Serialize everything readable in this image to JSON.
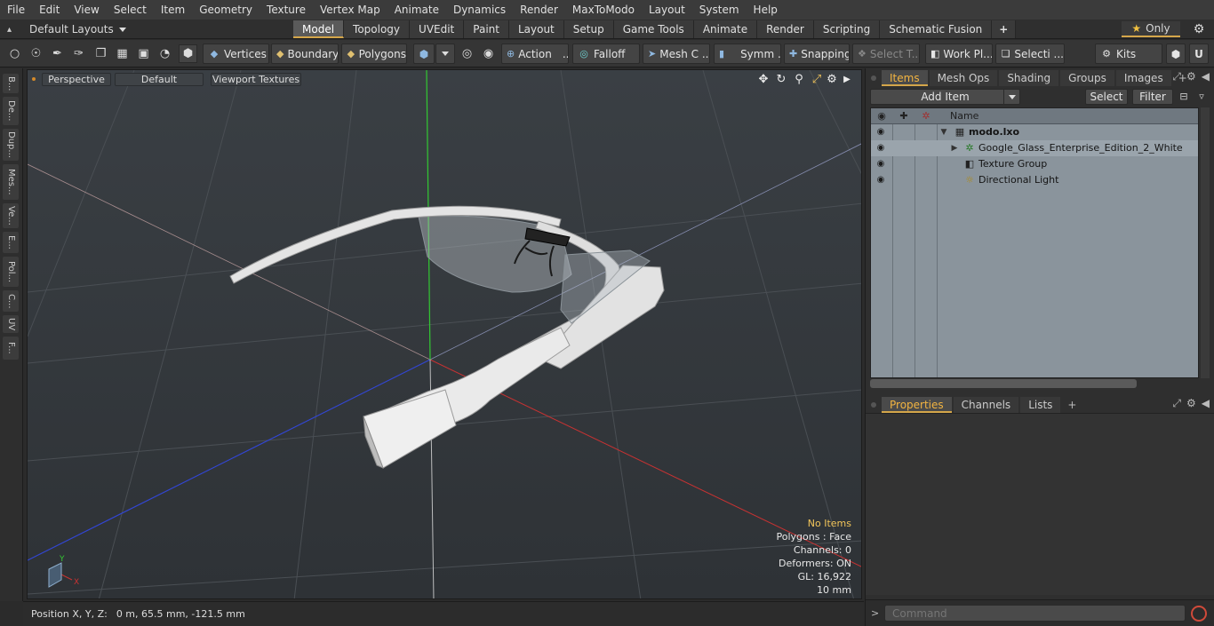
{
  "menubar": {
    "items": [
      "File",
      "Edit",
      "View",
      "Select",
      "Item",
      "Geometry",
      "Texture",
      "Vertex Map",
      "Animate",
      "Dynamics",
      "Render",
      "MaxToModo",
      "Layout",
      "System",
      "Help"
    ]
  },
  "layoutbar": {
    "layout_label": "Default Layouts",
    "tabs": [
      "Model",
      "Topology",
      "UVEdit",
      "Paint",
      "Layout",
      "Setup",
      "Game Tools",
      "Animate",
      "Render",
      "Scripting",
      "Schematic Fusion"
    ],
    "active_tab": "Model",
    "add_tab": "+",
    "only_label": "Only"
  },
  "toolbar": {
    "vertices": "Vertices",
    "boundary": "Boundary",
    "polygons": "Polygons",
    "action": "Action",
    "action_more": "...",
    "falloff": "Falloff",
    "mesh": "Mesh C ...",
    "symmetry": "Symm ...",
    "snapping": "Snapping",
    "select_tool": "Select T...",
    "workplane": "Work Pl...",
    "selection": "Selecti ...",
    "kits": "Kits"
  },
  "leftstrip": {
    "tabs": [
      "B...",
      "De...",
      "Dup...",
      "Mes...",
      "Ve...",
      "E...",
      "Pol...",
      "C...",
      "UV",
      "F..."
    ]
  },
  "viewport": {
    "view_mode": "Perspective",
    "shading": "Default",
    "textures": "Viewport Textures",
    "axis_y": "Y",
    "axis_x": "X",
    "hud": {
      "no_items": "No Items",
      "polygons": "Polygons : Face",
      "channels": "Channels: 0",
      "deformers": "Deformers: ON",
      "gl": "GL: 16,922",
      "scale": "10 mm"
    },
    "colors": {
      "x_axis": "#c83232",
      "y_axis": "#32c832",
      "z_axis": "#3246d2",
      "highlight": "#f2c55a"
    }
  },
  "statusbar": {
    "label": "Position X, Y, Z:",
    "value": "0 m, 65.5 mm, -121.5 mm"
  },
  "items_panel": {
    "tabs": [
      "Items",
      "Mesh Ops",
      "Shading",
      "Groups",
      "Images"
    ],
    "active_tab": "Items",
    "add_item": "Add Item",
    "select": "Select",
    "filter": "Filter",
    "name_header": "Name",
    "rows": [
      {
        "name": "modo.lxo",
        "icon": "scene-icon"
      },
      {
        "name": "Google_Glass_Enterprise_Edition_2_White",
        "icon": "mesh-locator-icon"
      },
      {
        "name": "Texture Group",
        "icon": "texture-group-icon"
      },
      {
        "name": "Directional Light",
        "icon": "light-icon"
      }
    ]
  },
  "props_panel": {
    "tabs": [
      "Properties",
      "Channels",
      "Lists"
    ],
    "active_tab": "Properties"
  },
  "command": {
    "placeholder": "Command"
  }
}
